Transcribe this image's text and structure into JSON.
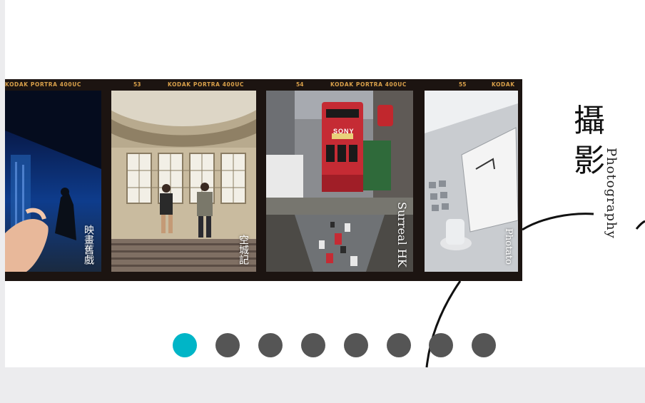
{
  "film": {
    "brand": "KODAK",
    "stock": "PORTRA 400UC",
    "frame_numbers": [
      "53",
      "54",
      "55"
    ]
  },
  "frames": [
    {
      "title": "映畫舊戲"
    },
    {
      "title": "空城記"
    },
    {
      "title": "Surreal HK",
      "sign_brand": "SONY"
    },
    {
      "title": "Photato"
    }
  ],
  "section": {
    "title_cn": "攝影",
    "title_en": "Photography"
  },
  "pagination": {
    "count": 8,
    "active_index": 0
  },
  "colors": {
    "accent": "#00b5c7",
    "dot": "#555555",
    "film_border": "#1c1411",
    "film_text": "#d9a04a"
  }
}
